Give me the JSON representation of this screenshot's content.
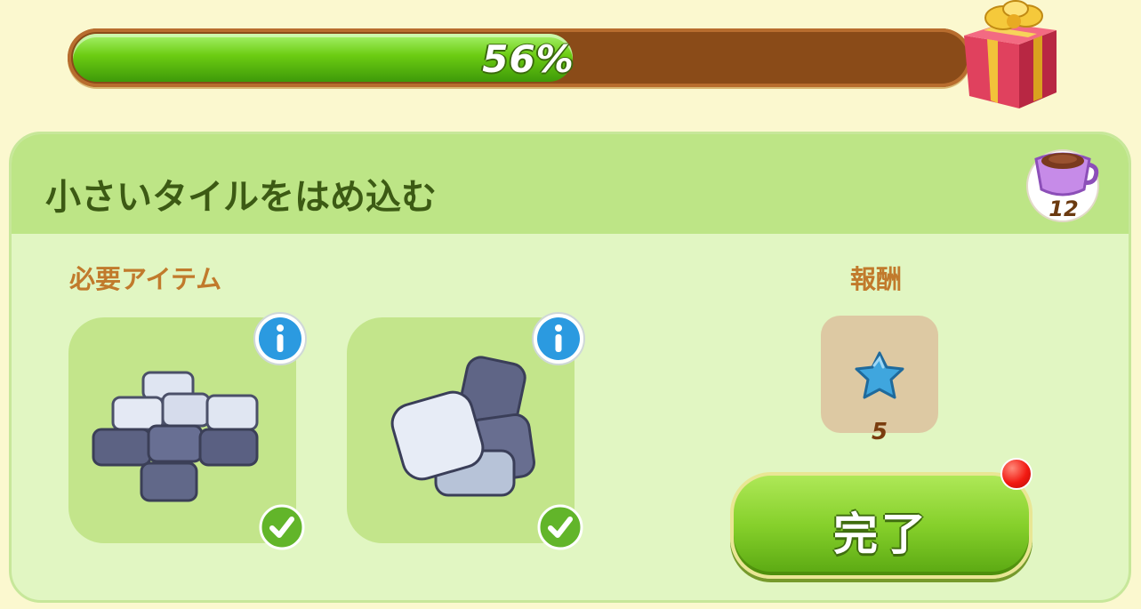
{
  "progress": {
    "value_percent": 56,
    "label": "56%"
  },
  "task": {
    "title": "小さいタイルをはめ込む",
    "cost": {
      "icon": "teacup-icon",
      "value": "12"
    },
    "required_label": "必要アイテム",
    "required_items": [
      {
        "icon": "stone-tiles-icon",
        "has_info": true,
        "completed": true
      },
      {
        "icon": "stone-pile-icon",
        "has_info": true,
        "completed": true
      }
    ],
    "reward_label": "報酬",
    "reward": {
      "icon": "blue-star-icon",
      "count": "5"
    }
  },
  "complete_button": {
    "label": "完了",
    "has_notification": true
  },
  "colors": {
    "progress_fill": "#6ccc12",
    "progress_track": "#8a4b18",
    "header_bg": "#bde586",
    "card_bg": "#e1f6c2",
    "notification": "#f21a12"
  }
}
